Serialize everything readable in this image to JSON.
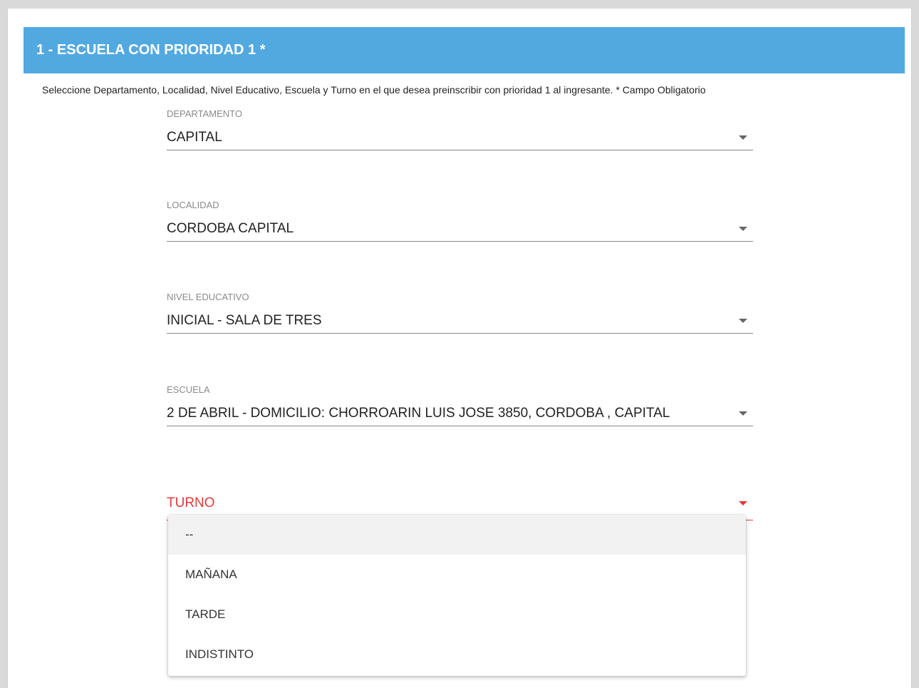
{
  "section": {
    "title": "1 - ESCUELA CON PRIORIDAD 1 *",
    "instructions": "Seleccione Departamento, Localidad, Nivel Educativo, Escuela y Turno en el que desea preinscribir con prioridad 1 al ingresante. * Campo Obligatorio"
  },
  "fields": {
    "departamento": {
      "label": "DEPARTAMENTO",
      "value": "CAPITAL"
    },
    "localidad": {
      "label": "LOCALIDAD",
      "value": "CORDOBA CAPITAL"
    },
    "nivel": {
      "label": "NIVEL EDUCATIVO",
      "value": "INICIAL - SALA DE TRES"
    },
    "escuela": {
      "label": "ESCUELA",
      "value": "2 DE ABRIL - DOMICILIO: CHORROARIN LUIS JOSE 3850, CORDOBA , CAPITAL"
    },
    "turno": {
      "label": "TURNO"
    }
  },
  "turno_menu": {
    "options": [
      "--",
      "MAÑANA",
      "TARDE",
      "INDISTINTO"
    ],
    "highlighted": "--"
  },
  "colors": {
    "header_bg": "#52a9e0",
    "error": "#e53935"
  },
  "icons": {
    "dropdown": "chevron-down-icon"
  }
}
